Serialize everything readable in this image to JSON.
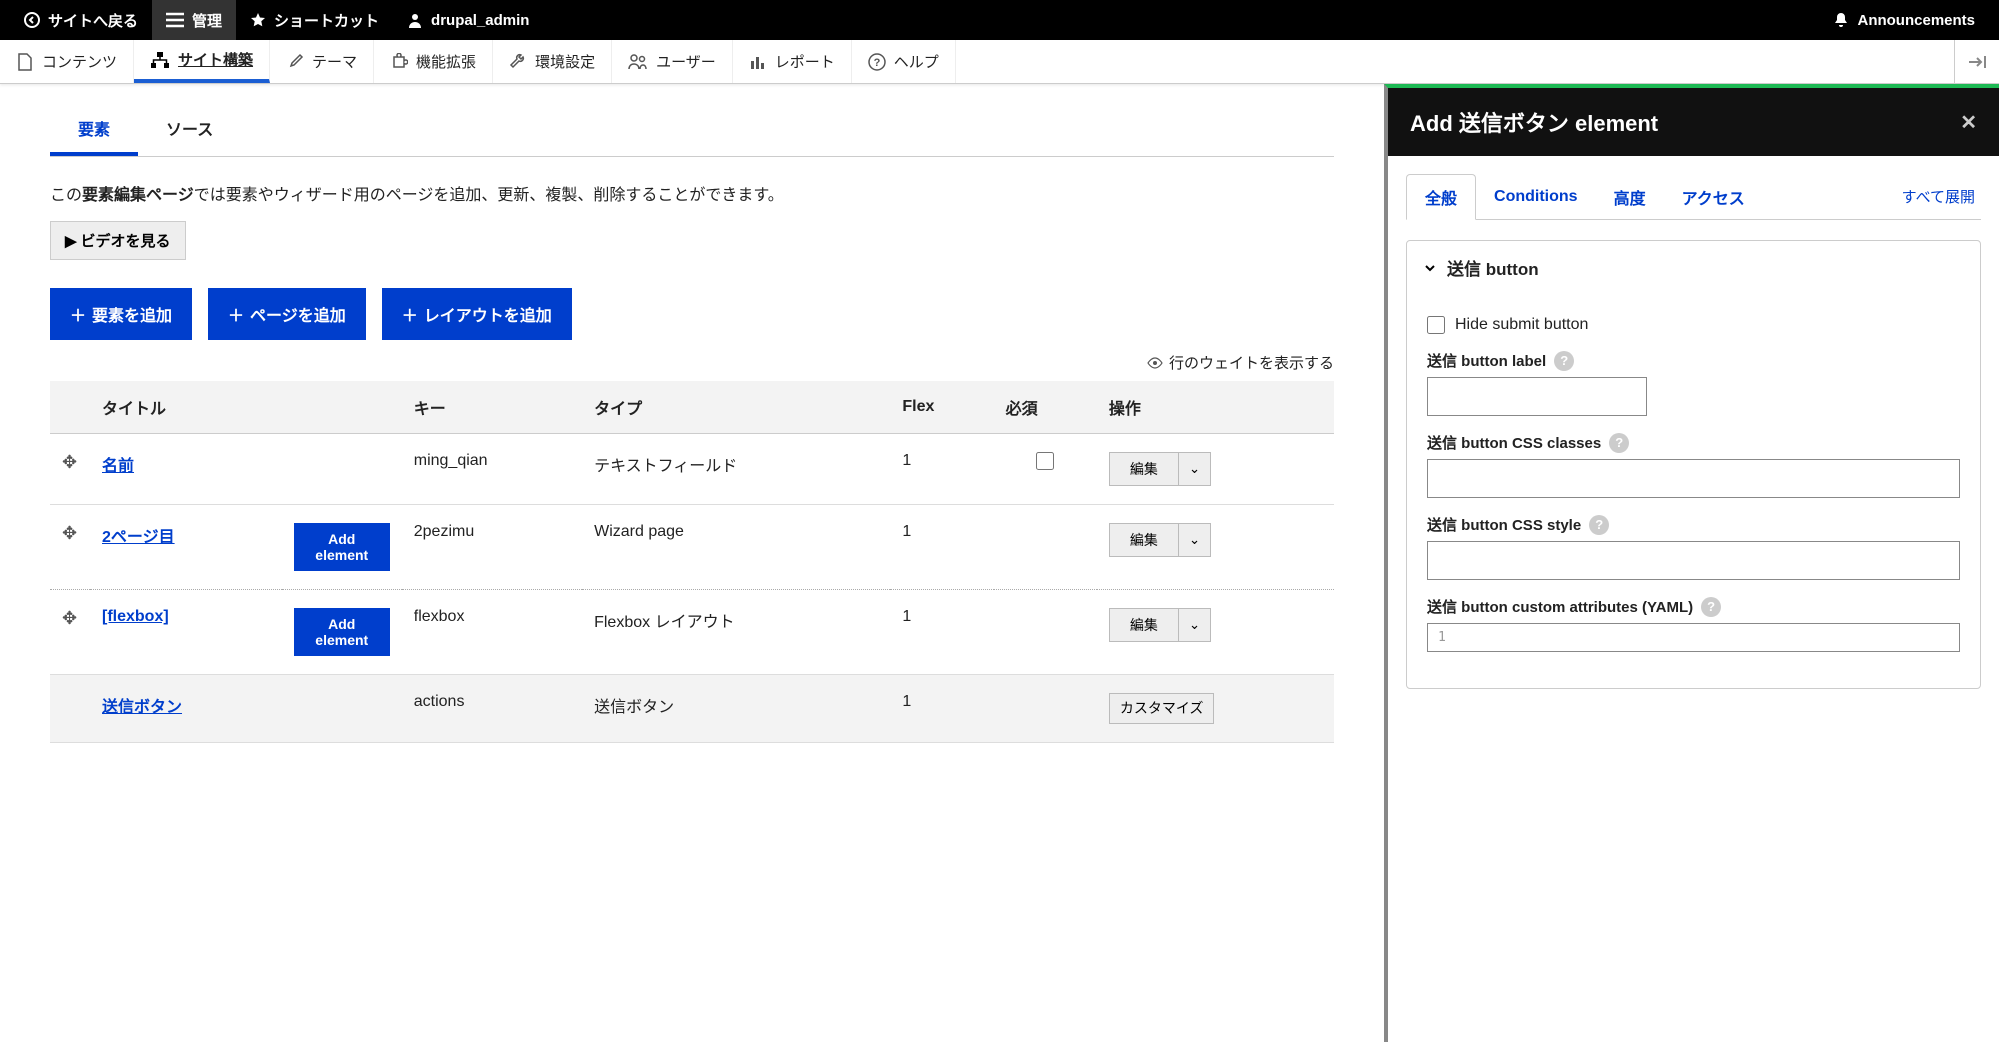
{
  "topbar": {
    "back": "サイトへ戻る",
    "manage": "管理",
    "shortcuts": "ショートカット",
    "user": "drupal_admin",
    "announcements": "Announcements"
  },
  "menubar": {
    "content": "コンテンツ",
    "structure": "サイト構築",
    "appearance": "テーマ",
    "extend": "機能拡張",
    "config": "環境設定",
    "people": "ユーザー",
    "reports": "レポート",
    "help": "ヘルプ"
  },
  "tabs": {
    "elements": "要素",
    "source": "ソース"
  },
  "description_prefix": "この",
  "description_bold": "要素編集ページ",
  "description_suffix": "では要素やウィザード用のページを追加、更新、複製、削除することができます。",
  "video_btn": "ビデオを見る",
  "buttons": {
    "add_element": "要素を追加",
    "add_page": "ページを追加",
    "add_layout": "レイアウトを追加"
  },
  "weight_toggle": "行のウェイトを表示する",
  "table": {
    "headers": {
      "title": "タイトル",
      "key": "キー",
      "type": "タイプ",
      "flex": "Flex",
      "required": "必須",
      "ops": "操作"
    },
    "rows": [
      {
        "title": "名前",
        "add_element": "",
        "key": "ming_qian",
        "type": "テキストフィールド",
        "flex": "1",
        "required_checkbox": true,
        "op": "編集"
      },
      {
        "title": "2ページ目",
        "add_element": "Add element",
        "key": "2pezimu",
        "type": "Wizard page",
        "flex": "1",
        "required_checkbox": false,
        "op": "編集"
      },
      {
        "title": "[flexbox]",
        "add_element": "Add element",
        "key": "flexbox",
        "type": "Flexbox レイアウト",
        "flex": "1",
        "required_checkbox": false,
        "op": "編集"
      },
      {
        "title": "送信ボタン",
        "add_element": "",
        "key": "actions",
        "type": "送信ボタン",
        "flex": "1",
        "required_checkbox": false,
        "op": "カスタマイズ"
      }
    ]
  },
  "side": {
    "title": "Add 送信ボタン element",
    "tabs": {
      "general": "全般",
      "conditions": "Conditions",
      "advanced": "高度",
      "access": "アクセス"
    },
    "expand_all": "すべて展開",
    "section_title": "送信 button",
    "hide_label": "Hide submit button",
    "label_label": "送信 button label",
    "css_classes_label": "送信 button CSS classes",
    "css_style_label": "送信 button CSS style",
    "yaml_label": "送信 button custom attributes (YAML)",
    "yaml_placeholder": "1"
  }
}
